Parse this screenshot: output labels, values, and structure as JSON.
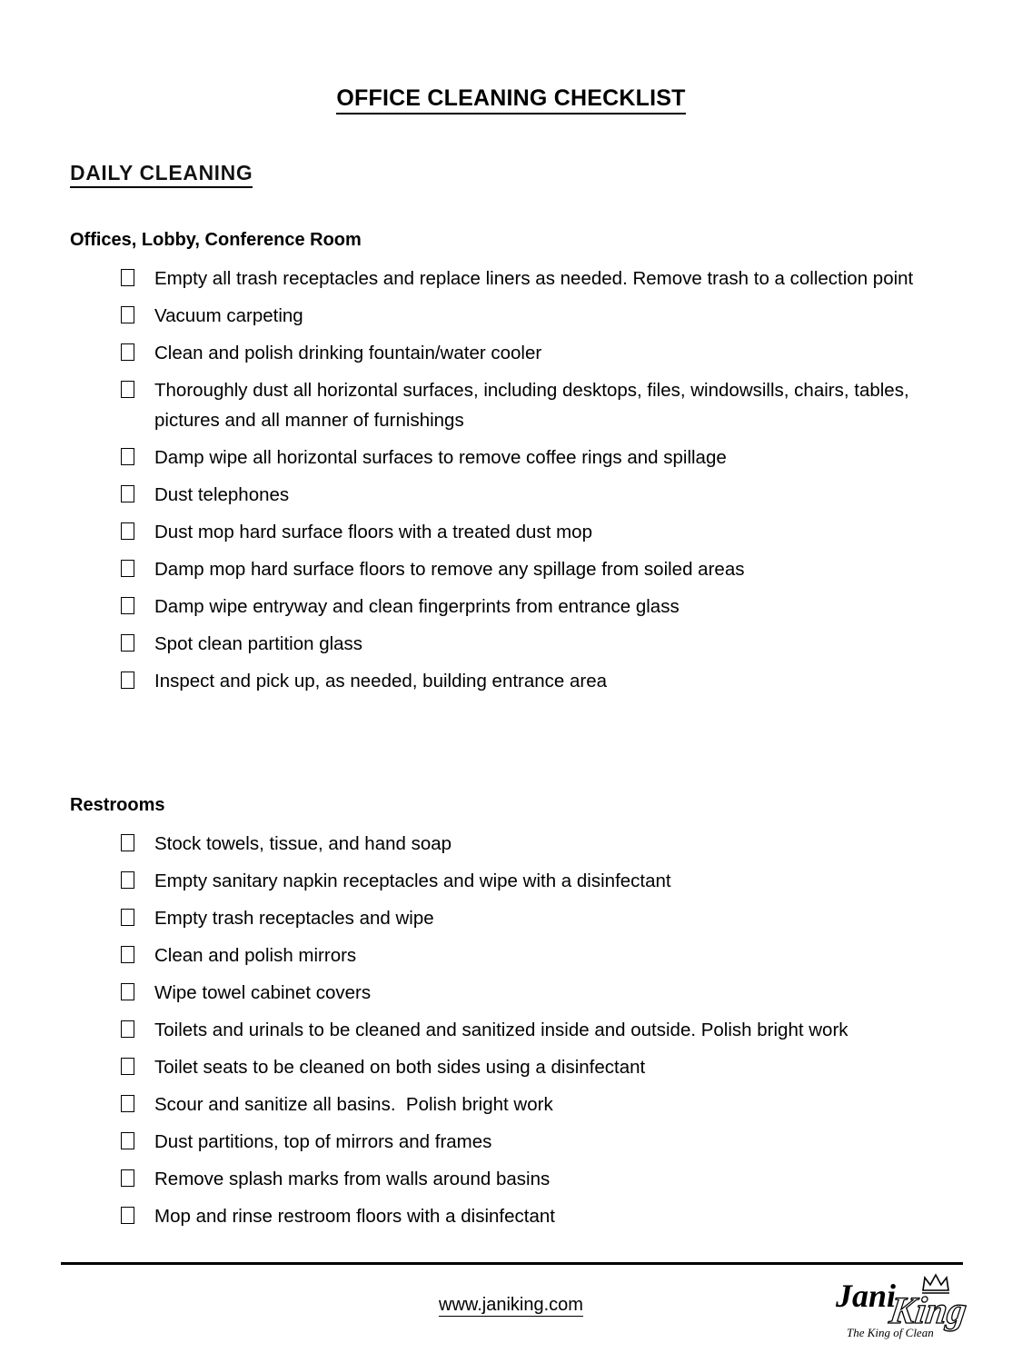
{
  "document": {
    "title": "OFFICE CLEANING CHECKLIST",
    "section_label": "DAILY CLEANING"
  },
  "groups": [
    {
      "heading": "Offices, Lobby, Conference Room",
      "items": [
        "Empty all trash receptacles and replace liners as needed. Remove trash to a collection point",
        "Vacuum carpeting",
        "Clean and polish drinking fountain/water cooler",
        "Thoroughly dust all horizontal surfaces, including desktops, files, windowsills, chairs, tables, pictures and all manner of furnishings",
        "Damp wipe all horizontal surfaces to remove coffee rings and spillage",
        "Dust telephones",
        "Dust mop hard surface floors with a treated dust mop",
        "Damp mop hard surface floors to remove any spillage from soiled areas",
        "Damp wipe entryway and clean fingerprints from entrance glass",
        "Spot clean partition glass",
        "Inspect and pick up, as needed, building entrance area"
      ]
    },
    {
      "heading": "Restrooms",
      "items": [
        "Stock towels, tissue, and hand soap",
        "Empty sanitary napkin receptacles and wipe with a disinfectant",
        "Empty trash receptacles and wipe",
        "Clean and polish mirrors",
        "Wipe towel cabinet covers",
        "Toilets and urinals to be cleaned and sanitized inside and outside. Polish bright work",
        "Toilet seats to be cleaned on both sides using a disinfectant",
        "Scour and sanitize all basins.  Polish bright work",
        "Dust partitions, top of mirrors and frames",
        "Remove splash marks from walls around basins",
        "Mop and rinse restroom floors with a disinfectant"
      ]
    }
  ],
  "footer": {
    "url": "www.janiking.com",
    "logo": {
      "word_primary": "Jani",
      "word_secondary": "King",
      "tagline": "The King of Clean"
    }
  },
  "colors": {
    "text": "#000000",
    "background": "#ffffff",
    "rule": "#000000"
  }
}
